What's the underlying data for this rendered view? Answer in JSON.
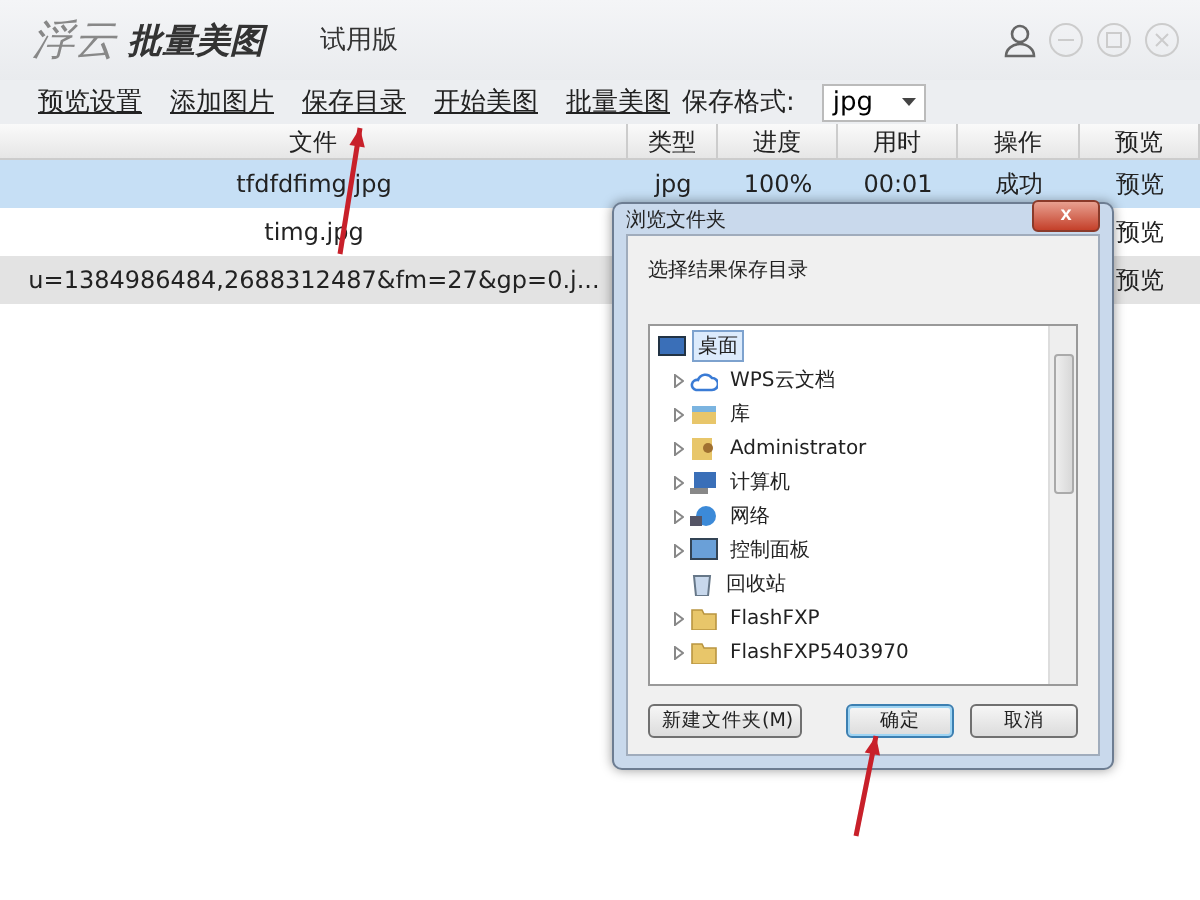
{
  "app": {
    "logo_left": "浮云",
    "logo_right": "批量美图",
    "edition": "试用版"
  },
  "toolbar": {
    "links": [
      "预览设置",
      "添加图片",
      "保存目录",
      "开始美图",
      "批量美图"
    ],
    "format_label": "保存格式:",
    "format_value": "jpg"
  },
  "table": {
    "columns": [
      "文件",
      "类型",
      "进度",
      "用时",
      "操作",
      "预览"
    ],
    "rows": [
      {
        "selected": true,
        "shaded": false,
        "cells": [
          "tfdfdfimg.jpg",
          "jpg",
          "100%",
          "00:01",
          "成功",
          "预览"
        ]
      },
      {
        "selected": false,
        "shaded": false,
        "cells": [
          "timg.jpg",
          null,
          null,
          null,
          null,
          "预览"
        ]
      },
      {
        "selected": false,
        "shaded": true,
        "cells": [
          "u=1384986484,2688312487&fm=27&gp=0.j...",
          null,
          null,
          null,
          null,
          "预览"
        ]
      }
    ]
  },
  "dialog": {
    "title": "浏览文件夹",
    "close": "x",
    "prompt": "选择结果保存目录",
    "tree": [
      {
        "label": "桌面",
        "kind": "desktop",
        "selected": true,
        "children": [
          {
            "label": "WPS云文档",
            "kind": "cloud",
            "expandable": true
          },
          {
            "label": "库",
            "kind": "library",
            "expandable": true
          },
          {
            "label": "Administrator",
            "kind": "user",
            "expandable": true
          },
          {
            "label": "计算机",
            "kind": "computer",
            "expandable": true
          },
          {
            "label": "网络",
            "kind": "network",
            "expandable": true
          },
          {
            "label": "控制面板",
            "kind": "panel",
            "expandable": true
          },
          {
            "label": "回收站",
            "kind": "recycle",
            "expandable": false
          },
          {
            "label": "FlashFXP",
            "kind": "folder",
            "expandable": true
          },
          {
            "label": "FlashFXP5403970",
            "kind": "folder",
            "expandable": true
          }
        ]
      }
    ],
    "buttons": [
      {
        "label": "新建文件夹(M)",
        "default": false
      },
      {
        "label": "确定",
        "default": true
      },
      {
        "label": "取消",
        "default": false
      }
    ]
  }
}
